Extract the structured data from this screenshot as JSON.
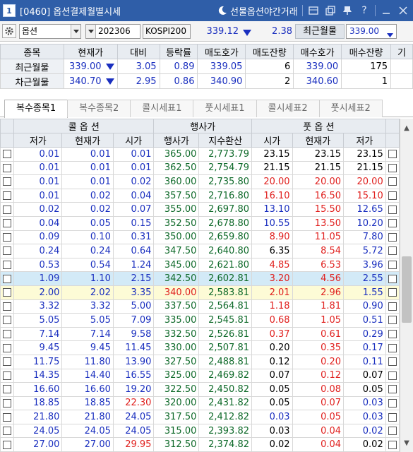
{
  "window": {
    "number": "1",
    "title": "[0460] 옵션결제월별시세",
    "night_link": "선물옵션야간거래",
    "icons": [
      "layout-icon",
      "copy-icon",
      "pin-icon",
      "help-icon",
      "minimize-icon",
      "close-icon"
    ]
  },
  "toolbar": {
    "product": "옵션",
    "month": "202306",
    "index_name": "KOSPI200",
    "index_value": "339.12",
    "index_change": "2.38",
    "month_label": "최근월물",
    "month_value": "339.00"
  },
  "summary": {
    "headers": [
      "종목",
      "현재가",
      "대비",
      "등락률",
      "매도호가",
      "매도잔량",
      "매수호가",
      "매수잔량",
      "기"
    ],
    "rows": [
      {
        "name": "최근월물",
        "price": "339.00",
        "change": "3.05",
        "rate": "0.89",
        "ask": "339.05",
        "ask_qty": "6",
        "bid": "339.00",
        "bid_qty": "175"
      },
      {
        "name": "차근월물",
        "price": "340.70",
        "change": "2.95",
        "rate": "0.86",
        "ask": "340.90",
        "ask_qty": "2",
        "bid": "340.60",
        "bid_qty": "1"
      }
    ]
  },
  "tabs": [
    "복수종목1",
    "복수종목2",
    "콜시세표1",
    "풋시세표1",
    "콜시세표2",
    "풋시세표2"
  ],
  "grid": {
    "group_headers": {
      "call": "콜 옵 션",
      "strike": "행사가",
      "put": "풋 옵 션"
    },
    "headers": [
      "저가",
      "현재가",
      "시가",
      "행사가",
      "지수환산",
      "시가",
      "현재가",
      "저가"
    ],
    "rows": [
      [
        "0.01",
        "0.01",
        "0.01",
        "365.00",
        "2,773.79",
        "23.15",
        "23.15",
        "23.15"
      ],
      [
        "0.01",
        "0.01",
        "0.01",
        "362.50",
        "2,754.79",
        "21.15",
        "21.15",
        "21.15"
      ],
      [
        "0.01",
        "0.01",
        "0.02",
        "360.00",
        "2,735.80",
        "20.00",
        "20.00",
        "20.00"
      ],
      [
        "0.01",
        "0.02",
        "0.04",
        "357.50",
        "2,716.80",
        "16.10",
        "16.50",
        "15.10"
      ],
      [
        "0.02",
        "0.02",
        "0.07",
        "355.00",
        "2,697.80",
        "13.10",
        "15.50",
        "12.65"
      ],
      [
        "0.04",
        "0.05",
        "0.15",
        "352.50",
        "2,678.80",
        "10.55",
        "13.50",
        "10.20"
      ],
      [
        "0.09",
        "0.10",
        "0.31",
        "350.00",
        "2,659.80",
        "8.90",
        "11.05",
        "7.80"
      ],
      [
        "0.24",
        "0.24",
        "0.64",
        "347.50",
        "2,640.80",
        "6.35",
        "8.54",
        "5.72"
      ],
      [
        "0.53",
        "0.54",
        "1.24",
        "345.00",
        "2,621.80",
        "4.85",
        "6.53",
        "3.96"
      ],
      [
        "1.09",
        "1.10",
        "2.15",
        "342.50",
        "2,602.81",
        "3.20",
        "4.56",
        "2.55"
      ],
      [
        "2.00",
        "2.02",
        "3.35",
        "340.00",
        "2,583.81",
        "2.01",
        "2.96",
        "1.55"
      ],
      [
        "3.32",
        "3.32",
        "5.00",
        "337.50",
        "2,564.81",
        "1.18",
        "1.81",
        "0.90"
      ],
      [
        "5.05",
        "5.05",
        "7.09",
        "335.00",
        "2,545.81",
        "0.68",
        "1.05",
        "0.51"
      ],
      [
        "7.14",
        "7.14",
        "9.58",
        "332.50",
        "2,526.81",
        "0.37",
        "0.61",
        "0.29"
      ],
      [
        "9.45",
        "9.45",
        "11.45",
        "330.00",
        "2,507.81",
        "0.20",
        "0.35",
        "0.17"
      ],
      [
        "11.75",
        "11.80",
        "13.90",
        "327.50",
        "2,488.81",
        "0.12",
        "0.20",
        "0.11"
      ],
      [
        "14.35",
        "14.40",
        "16.55",
        "325.00",
        "2,469.82",
        "0.07",
        "0.12",
        "0.07"
      ],
      [
        "16.60",
        "16.60",
        "19.20",
        "322.50",
        "2,450.82",
        "0.05",
        "0.08",
        "0.05"
      ],
      [
        "18.85",
        "18.85",
        "22.30",
        "320.00",
        "2,431.82",
        "0.05",
        "0.07",
        "0.03"
      ],
      [
        "21.80",
        "21.80",
        "24.05",
        "317.50",
        "2,412.82",
        "0.03",
        "0.05",
        "0.03"
      ],
      [
        "24.05",
        "24.05",
        "24.05",
        "315.00",
        "2,393.82",
        "0.03",
        "0.04",
        "0.02"
      ],
      [
        "27.00",
        "27.00",
        "29.95",
        "312.50",
        "2,374.82",
        "0.02",
        "0.04",
        "0.02"
      ]
    ],
    "colors": [
      [
        "b",
        "b",
        "b",
        "g",
        "g",
        "k",
        "k",
        "k"
      ],
      [
        "b",
        "b",
        "b",
        "g",
        "g",
        "k",
        "k",
        "k"
      ],
      [
        "b",
        "b",
        "b",
        "g",
        "g",
        "r",
        "r",
        "r"
      ],
      [
        "b",
        "b",
        "b",
        "g",
        "g",
        "r",
        "r",
        "r"
      ],
      [
        "b",
        "b",
        "b",
        "g",
        "g",
        "b",
        "r",
        "b"
      ],
      [
        "b",
        "b",
        "b",
        "g",
        "g",
        "b",
        "r",
        "b"
      ],
      [
        "b",
        "b",
        "b",
        "g",
        "g",
        "r",
        "r",
        "b"
      ],
      [
        "b",
        "b",
        "b",
        "g",
        "g",
        "k",
        "r",
        "b"
      ],
      [
        "b",
        "b",
        "b",
        "g",
        "g",
        "r",
        "r",
        "b"
      ],
      [
        "b",
        "b",
        "b",
        "g",
        "g",
        "r",
        "r",
        "b"
      ],
      [
        "b",
        "b",
        "b",
        "r",
        "g",
        "r",
        "r",
        "b"
      ],
      [
        "b",
        "b",
        "b",
        "g",
        "g",
        "r",
        "r",
        "b"
      ],
      [
        "b",
        "b",
        "b",
        "g",
        "g",
        "r",
        "r",
        "b"
      ],
      [
        "b",
        "b",
        "b",
        "g",
        "g",
        "r",
        "r",
        "b"
      ],
      [
        "b",
        "b",
        "b",
        "g",
        "g",
        "k",
        "r",
        "b"
      ],
      [
        "b",
        "b",
        "b",
        "g",
        "g",
        "k",
        "r",
        "b"
      ],
      [
        "b",
        "b",
        "b",
        "g",
        "g",
        "k",
        "r",
        "k"
      ],
      [
        "b",
        "b",
        "b",
        "g",
        "g",
        "k",
        "r",
        "k"
      ],
      [
        "b",
        "b",
        "r",
        "g",
        "g",
        "k",
        "r",
        "b"
      ],
      [
        "b",
        "b",
        "b",
        "g",
        "g",
        "b",
        "r",
        "b"
      ],
      [
        "b",
        "b",
        "b",
        "g",
        "g",
        "k",
        "r",
        "b"
      ],
      [
        "b",
        "b",
        "r",
        "g",
        "g",
        "k",
        "r",
        "k"
      ]
    ],
    "highlighted_row": 9,
    "atm_row": 10
  }
}
